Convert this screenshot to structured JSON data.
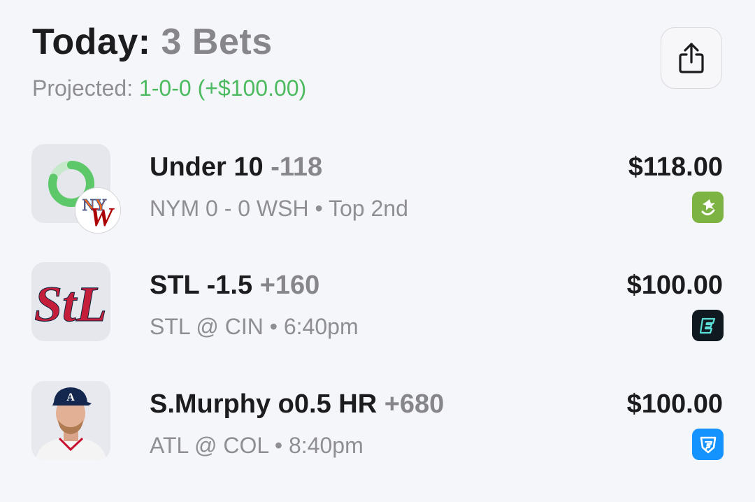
{
  "header": {
    "title_prefix": "Today:",
    "title_count": "3 Bets",
    "projected_label": "Projected:",
    "projected_value": "1-0-0 (+$100.00)",
    "share_icon": "share-icon"
  },
  "colors": {
    "projected_green": "#4cba5f",
    "progress_green": "#5cc86a",
    "progress_track": "#c6e9cb",
    "mets_orange": "#f26b21",
    "nationals_red": "#ab0003",
    "cardinals_red": "#c41e3a",
    "draftkings_green": "#7cb342",
    "espnbet_dark": "#101820",
    "espnbet_teal": "#5ce0d8",
    "fanduel_blue": "#1493ff"
  },
  "bets": [
    {
      "title": "Under 10",
      "odds": "-118",
      "subtitle": "NYM 0 - 0 WSH • Top 2nd",
      "amount": "$118.00",
      "thumb_icon": "live-progress-ring-icon",
      "team_badge_icon": "mets-nationals-logo-icon",
      "book_icon": "draftkings-icon",
      "progress": 0.8
    },
    {
      "title": "STL -1.5",
      "odds": "+160",
      "subtitle": "STL @ CIN • 6:40pm",
      "amount": "$100.00",
      "thumb_icon": "cardinals-logo-icon",
      "book_icon": "espn-bet-icon"
    },
    {
      "title": "S.Murphy o0.5 HR",
      "odds": "+680",
      "subtitle": "ATL @ COL • 8:40pm",
      "amount": "$100.00",
      "thumb_icon": "player-headshot-icon",
      "book_icon": "fanduel-icon"
    }
  ]
}
